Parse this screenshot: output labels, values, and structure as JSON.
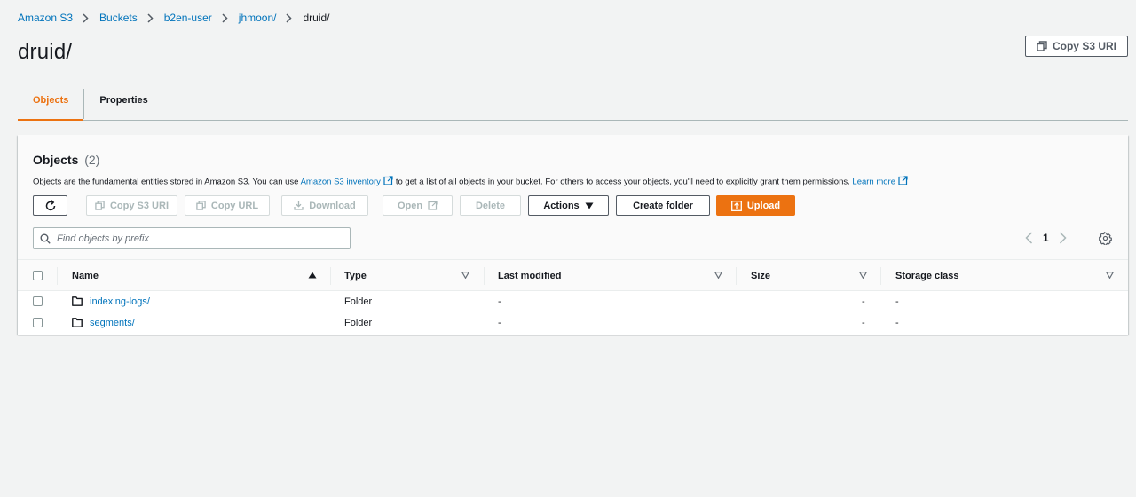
{
  "breadcrumb": [
    {
      "label": "Amazon S3"
    },
    {
      "label": "Buckets"
    },
    {
      "label": "b2en-user"
    },
    {
      "label": "jhmoon/"
    },
    {
      "label": "druid/"
    }
  ],
  "page": {
    "title": "druid/",
    "copy_s3_uri": "Copy S3 URI"
  },
  "tabs": [
    {
      "label": "Objects",
      "active": true
    },
    {
      "label": "Properties",
      "active": false
    }
  ],
  "objects": {
    "title": "Objects",
    "count": "(2)",
    "desc_part1": "Objects are the fundamental entities stored in Amazon S3. You can use",
    "desc_link1": "Amazon S3 inventory",
    "desc_part2": "to get a list of all objects in your bucket. For others to access your objects, you'll need to explicitly grant them permissions.",
    "desc_link2": "Learn more",
    "toolbar": {
      "copy_s3_uri": "Copy S3 URI",
      "copy_url": "Copy URL",
      "download": "Download",
      "open": "Open",
      "delete": "Delete",
      "actions": "Actions",
      "create_folder": "Create folder",
      "upload": "Upload"
    },
    "search_placeholder": "Find objects by prefix",
    "page_number": "1",
    "columns": {
      "name": "Name",
      "type": "Type",
      "last_modified": "Last modified",
      "size": "Size",
      "storage_class": "Storage class"
    },
    "rows": [
      {
        "name": "indexing-logs/",
        "type": "Folder",
        "last_modified": "-",
        "size": "-",
        "storage_class": "-"
      },
      {
        "name": "segments/",
        "type": "Folder",
        "last_modified": "-",
        "size": "-",
        "storage_class": "-"
      }
    ]
  },
  "colors": {
    "accent_orange": "#ec7211",
    "link_blue": "#0073bb",
    "page_bg": "#f2f3f3"
  }
}
